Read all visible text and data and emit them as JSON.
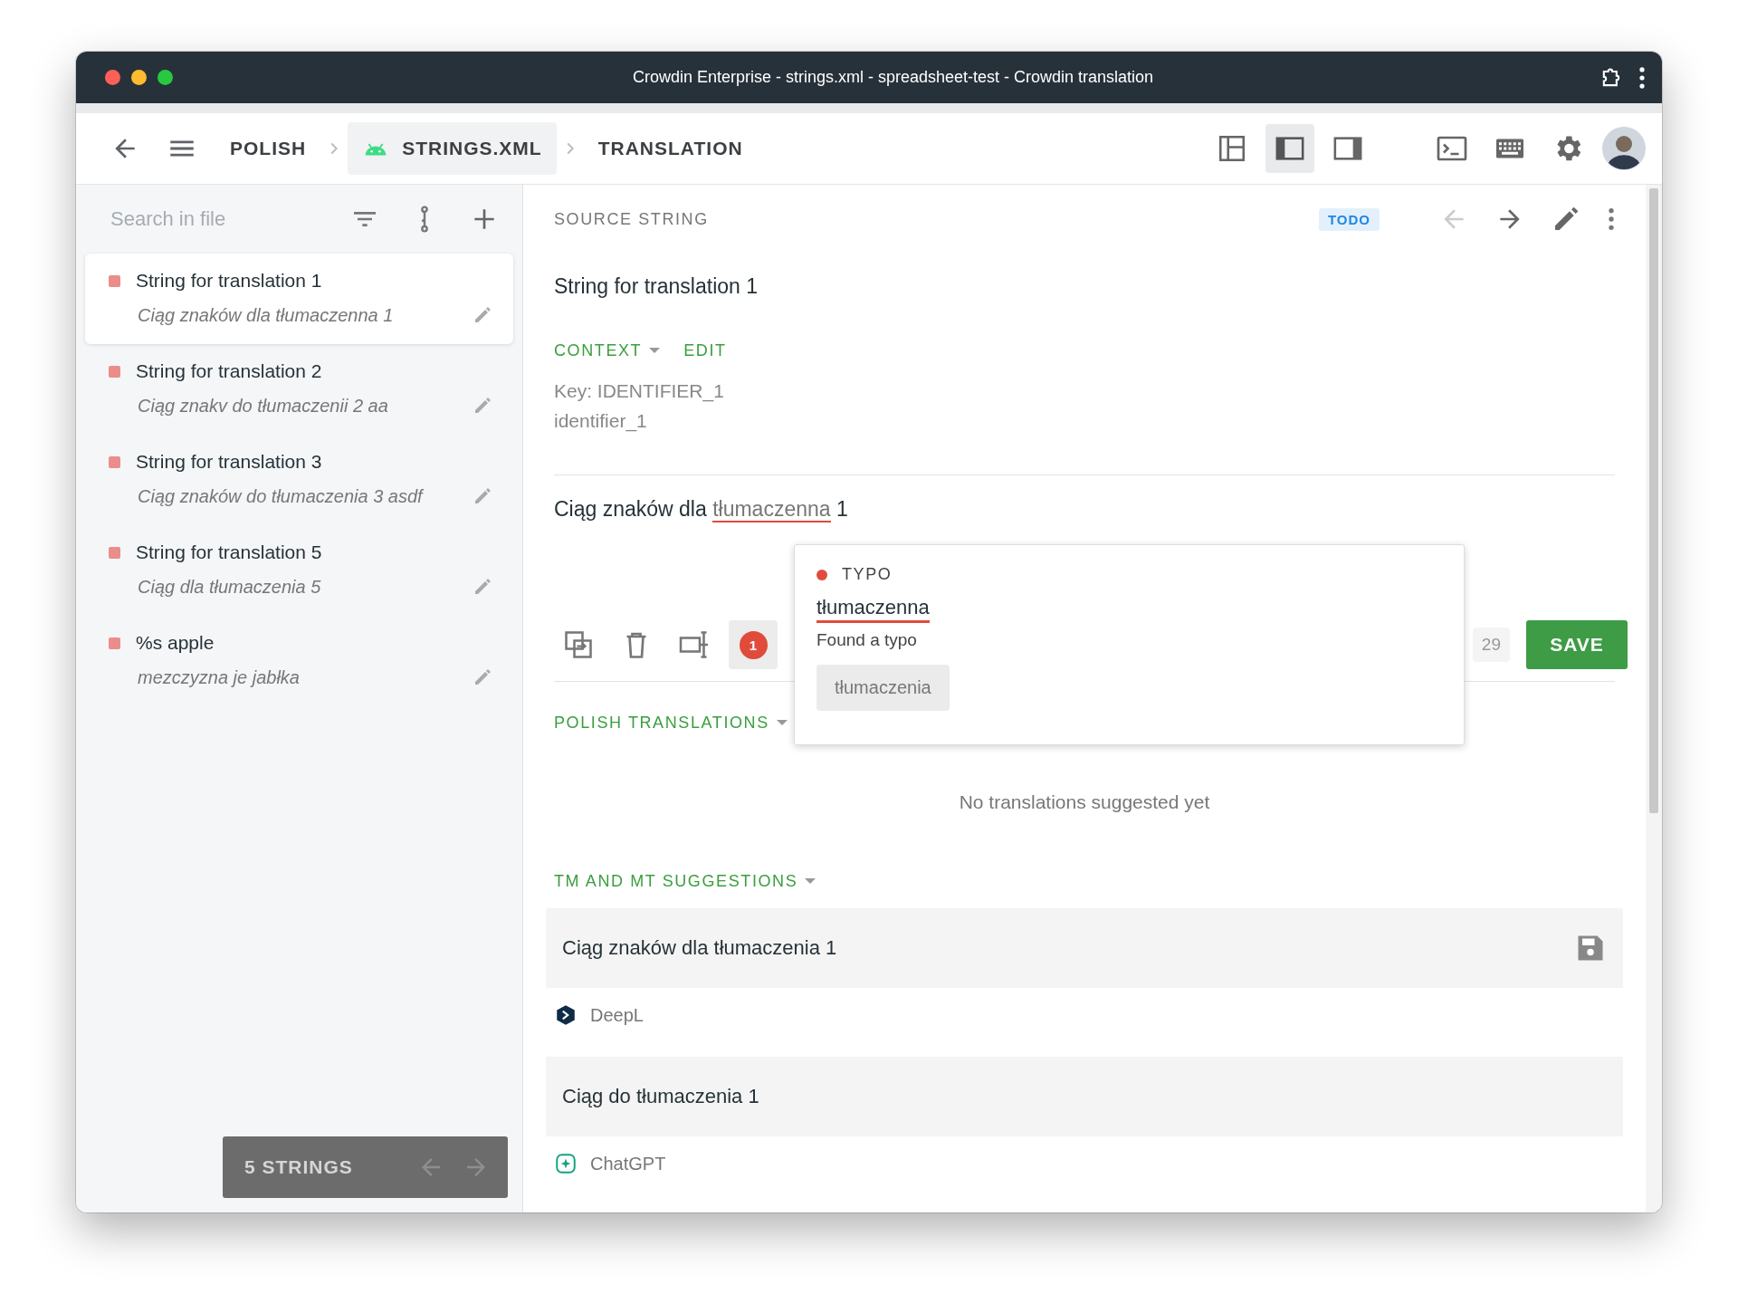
{
  "window": {
    "title": "Crowdin Enterprise - strings.xml - spreadsheet-test - Crowdin translation"
  },
  "breadcrumbs": [
    {
      "label": "POLISH",
      "kind": "plain"
    },
    {
      "label": "STRINGS.XML",
      "kind": "file"
    },
    {
      "label": "TRANSLATION",
      "kind": "plain"
    }
  ],
  "layout_buttons": [
    {
      "kind": "grid",
      "selected": false
    },
    {
      "kind": "left",
      "selected": true
    },
    {
      "kind": "right",
      "selected": false
    }
  ],
  "sidebar": {
    "search": {
      "placeholder": "Search in file"
    },
    "strings": [
      {
        "source": "String for translation 1",
        "translation": "Ciąg znaków dla tłumaczenna 1",
        "selected": true
      },
      {
        "source": "String for translation 2",
        "translation": "Ciąg znakv do tłumaczenii 2 aa",
        "selected": false
      },
      {
        "source": "String for translation 3",
        "translation": "Ciąg znaków do tłumaczenia 3 asdf",
        "selected": false
      },
      {
        "source": "String for translation 5",
        "translation": "Ciąg dla tłumaczenia 5",
        "selected": false
      },
      {
        "source": "%s apple",
        "translation": "mezczyzna je jabłka",
        "selected": false
      }
    ],
    "footer": {
      "count": "5 STRINGS"
    }
  },
  "editor": {
    "header": "SOURCE STRING",
    "status": "TODO",
    "source": "String for translation 1",
    "context_label": "CONTEXT",
    "edit_label": "EDIT",
    "context_lines": [
      "Key: IDENTIFIER_1",
      "identifier_1"
    ],
    "translation_parts": [
      {
        "text": "Ciąg znaków dla ",
        "typo": false
      },
      {
        "text": "tłumaczenna",
        "typo": true
      },
      {
        "text": " 1",
        "typo": false
      }
    ],
    "issue_count": "1",
    "char_count": "29",
    "save": "SAVE"
  },
  "popup": {
    "category": "TYPO",
    "word": "tłumaczenna",
    "message": "Found a typo",
    "suggestions": [
      "tłumaczenia"
    ]
  },
  "polish_translations": {
    "title": "POLISH TRANSLATIONS",
    "empty": "No translations suggested yet"
  },
  "tm_suggestions": {
    "title": "TM AND MT SUGGESTIONS",
    "items": [
      {
        "text": "Ciąg znaków dla tłumaczenia 1",
        "engine": "DeepL",
        "kind": "deepl",
        "hovered": true
      },
      {
        "text": "Ciąg do tłumaczenia 1",
        "engine": "ChatGPT",
        "kind": "chatgpt",
        "hovered": false
      }
    ]
  }
}
